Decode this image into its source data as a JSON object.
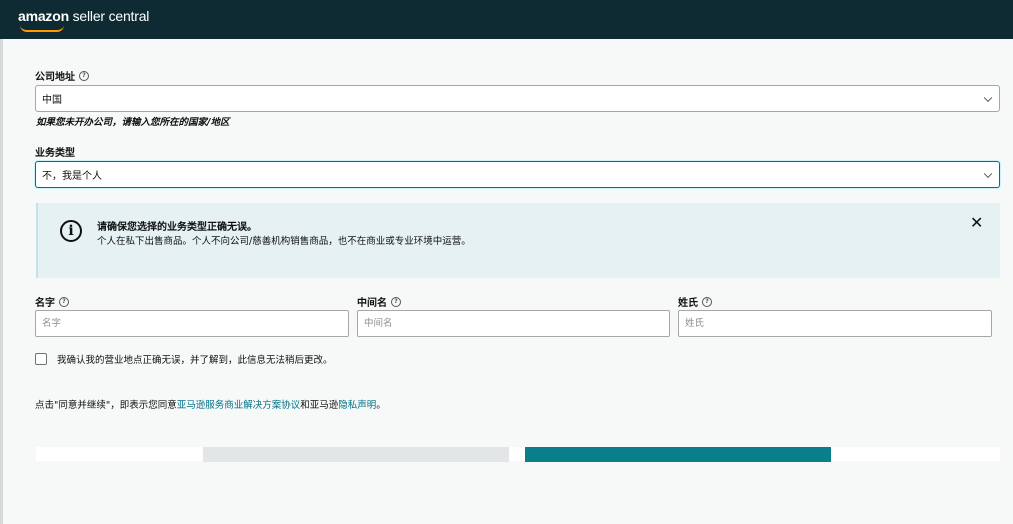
{
  "header": {
    "logo_brand": "amazon",
    "logo_rest": " seller central"
  },
  "company_address": {
    "label": "公司地址",
    "value": "中国",
    "hint": "如果您未开办公司，请输入您所在的国家/地区"
  },
  "business_type": {
    "label": "业务类型",
    "value": "不，我是个人"
  },
  "alert": {
    "title": "请确保您选择的业务类型正确无误。",
    "body": "个人在私下出售商品。个人不向公司/慈善机构销售商品，也不在商业或专业环境中运营。"
  },
  "name_fields": {
    "first": {
      "label": "名字",
      "placeholder": "名字"
    },
    "middle": {
      "label": "中间名",
      "placeholder": "中间名"
    },
    "last": {
      "label": "姓氏",
      "placeholder": "姓氏"
    }
  },
  "confirm": {
    "label": "我确认我的营业地点正确无误，并了解到，此信息无法稍后更改。"
  },
  "terms": {
    "prefix": "点击\"同意并继续\"，即表示您同意",
    "link1": "亚马逊服务商业解决方案协议",
    "middle": "和亚马逊",
    "link2": "隐私声明",
    "suffix": "。"
  },
  "colors": {
    "header_bg": "#0e2a33",
    "accent": "#007185",
    "primary_button": "#0a7f8c"
  }
}
